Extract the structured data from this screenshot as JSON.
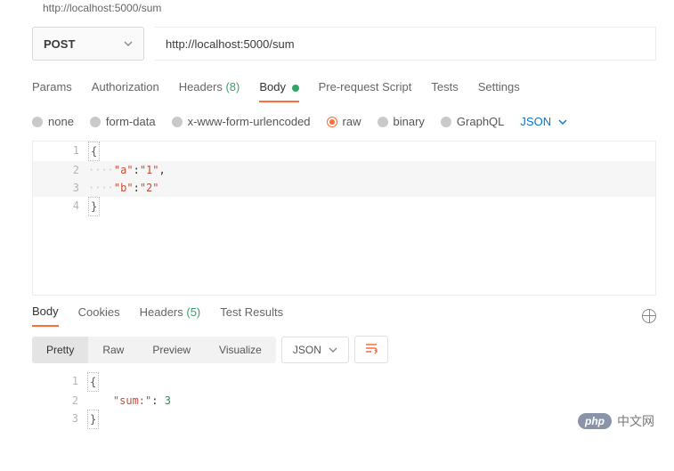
{
  "header": {
    "fragment": "http://localhost:5000/sum"
  },
  "request": {
    "method": "POST",
    "url": "http://localhost:5000/sum"
  },
  "requestTabs": {
    "params": "Params",
    "authorization": "Authorization",
    "headers_label": "Headers",
    "headers_count": "(8)",
    "body": "Body",
    "prerequest": "Pre-request Script",
    "tests": "Tests",
    "settings": "Settings"
  },
  "bodyTypes": {
    "none": "none",
    "formdata": "form-data",
    "urlencoded": "x-www-form-urlencoded",
    "raw": "raw",
    "binary": "binary",
    "graphql": "GraphQL",
    "formatLabel": "JSON"
  },
  "requestBody": {
    "line1_open": "{",
    "line2_key": "\"a\"",
    "line2_sep": ":",
    "line2_val": "\"1\"",
    "line2_comma": ",",
    "line3_key": "\"b\"",
    "line3_sep": ":",
    "line3_val": "\"2\"",
    "line4_close": "}",
    "ln1": "1",
    "ln2": "2",
    "ln3": "3",
    "ln4": "4"
  },
  "responseTabs": {
    "body": "Body",
    "cookies": "Cookies",
    "headers_label": "Headers",
    "headers_count": "(5)",
    "testresults": "Test Results"
  },
  "viewModes": {
    "pretty": "Pretty",
    "raw": "Raw",
    "preview": "Preview",
    "visualize": "Visualize",
    "lang": "JSON"
  },
  "responseBody": {
    "line1_open": "{",
    "line2_key": "\"sum:\"",
    "line2_sep": ": ",
    "line2_val": "3",
    "line3_close": "}",
    "ln1": "1",
    "ln2": "2",
    "ln3": "3"
  },
  "watermark": {
    "php": "php",
    "text": "中文网"
  }
}
